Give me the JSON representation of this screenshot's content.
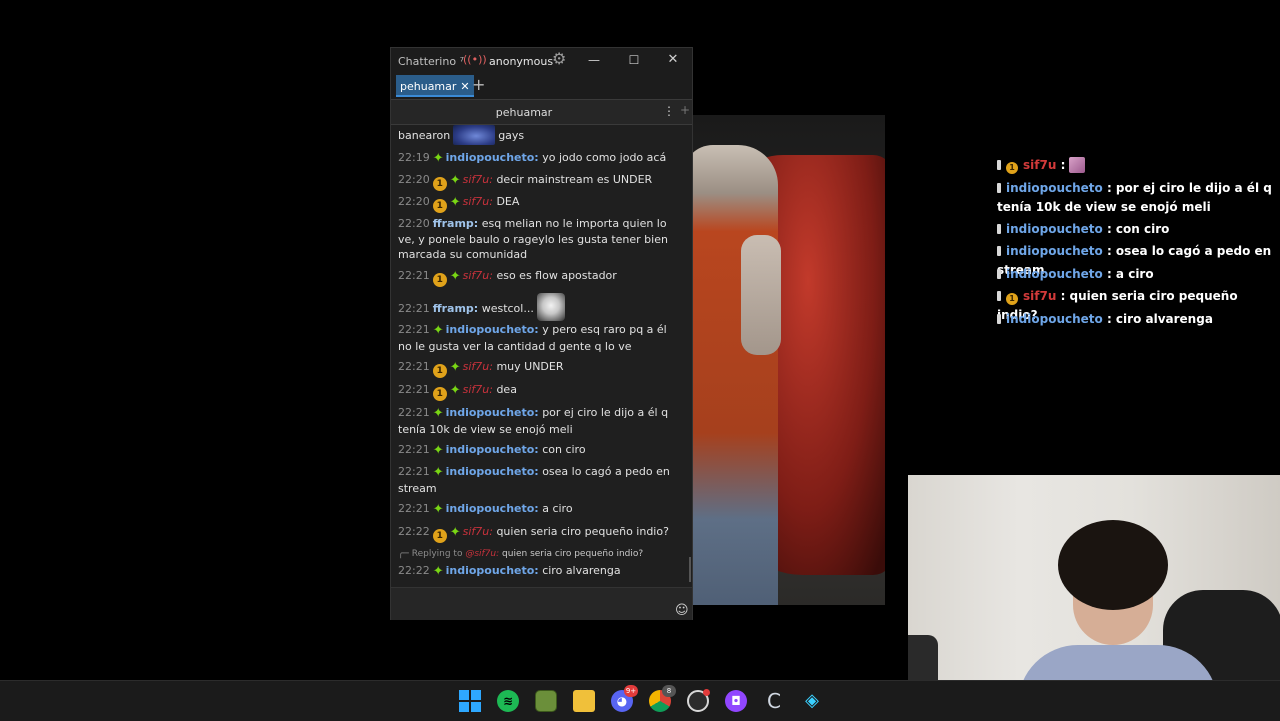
{
  "window": {
    "app_title": "Chatterino ⁷",
    "account": "anonymous",
    "controls": {
      "minimize": "—",
      "maximize": "☐",
      "close": "✕"
    }
  },
  "tabs": [
    {
      "label": "pehuamar",
      "close": "✕"
    }
  ],
  "add_tab": "+",
  "split": {
    "channel": "pehuamar",
    "menu": "⋮",
    "add": "+"
  },
  "messages": [
    {
      "text_before": "banearon",
      "text_after": "gays"
    },
    {
      "time": "22:19",
      "user": "indiopoucheto:",
      "text": "yo jodo como jodo acá"
    },
    {
      "time": "22:20",
      "user": "sif7u:",
      "text": "decir mainstream es UNDER"
    },
    {
      "time": "22:20",
      "user": "sif7u:",
      "text": "DEA"
    },
    {
      "time": "22:20",
      "user": "fframp:",
      "text": "esq melian no le importa quien lo ve, y ponele baulo o rageylo les gusta tener bien marcada su comunidad"
    },
    {
      "time": "22:21",
      "user": "sif7u:",
      "text": "eso es flow apostador"
    },
    {
      "time": "22:21",
      "user": "fframp:",
      "text": "westcol..."
    },
    {
      "time": "22:21",
      "user": "indiopoucheto:",
      "text": "y pero esq raro pq a él no le gusta ver la cantidad d gente q lo ve"
    },
    {
      "time": "22:21",
      "user": "sif7u:",
      "text": "muy UNDER"
    },
    {
      "time": "22:21",
      "user": "sif7u:",
      "text": "dea"
    },
    {
      "time": "22:21",
      "user": "indiopoucheto:",
      "text": "por ej ciro le dijo a él q tenía 10k de view se enojó meli"
    },
    {
      "time": "22:21",
      "user": "indiopoucheto:",
      "text": "con ciro"
    },
    {
      "time": "22:21",
      "user": "indiopoucheto:",
      "text": "osea lo cagó a pedo en stream"
    },
    {
      "time": "22:21",
      "user": "indiopoucheto:",
      "text": "a ciro"
    },
    {
      "time": "22:22",
      "user": "sif7u:",
      "text": "quien seria ciro pequeño indio?"
    },
    {
      "time": "22:22",
      "user": "indiopoucheto:",
      "text": "ciro alvarenga",
      "reply_prefix": "Replying to",
      "reply_user": "@sif7u:",
      "reply_text": "quien seria ciro pequeño indio?"
    }
  ],
  "badges": {
    "sub": "1",
    "star": "✦"
  },
  "overlay": [
    {
      "user": "sif7u",
      "text": ":"
    },
    {
      "user": "indiopoucheto",
      "text": ": por ej ciro le dijo a él q tenía 10k de view se enojó meli"
    },
    {
      "user": "indiopoucheto",
      "text": ": con ciro"
    },
    {
      "user": "indiopoucheto",
      "text": ": osea lo cagó a pedo en stream"
    },
    {
      "user": "indiopoucheto",
      "text": ": a ciro"
    },
    {
      "user": "sif7u",
      "text": ": quien seria ciro pequeño indio?"
    },
    {
      "user": "indiopoucheto",
      "text": ": ciro alvarenga"
    }
  ],
  "taskbar": {
    "discord_badge": "9+",
    "chrome_badge": "8",
    "icons": [
      "windows-start-icon",
      "spotify-icon",
      "minecraft-icon",
      "folder-icon",
      "discord-icon",
      "chrome-icon",
      "obs-icon",
      "twitch-icon",
      "chatterino-icon",
      "streamlabs-icon"
    ]
  },
  "colors": {
    "username_indio": "#6fa6e8",
    "username_sif": "#c8323c",
    "tab_active": "#2b5d8a",
    "star_badge": "#79d614",
    "sub_badge": "#e0a21a"
  }
}
